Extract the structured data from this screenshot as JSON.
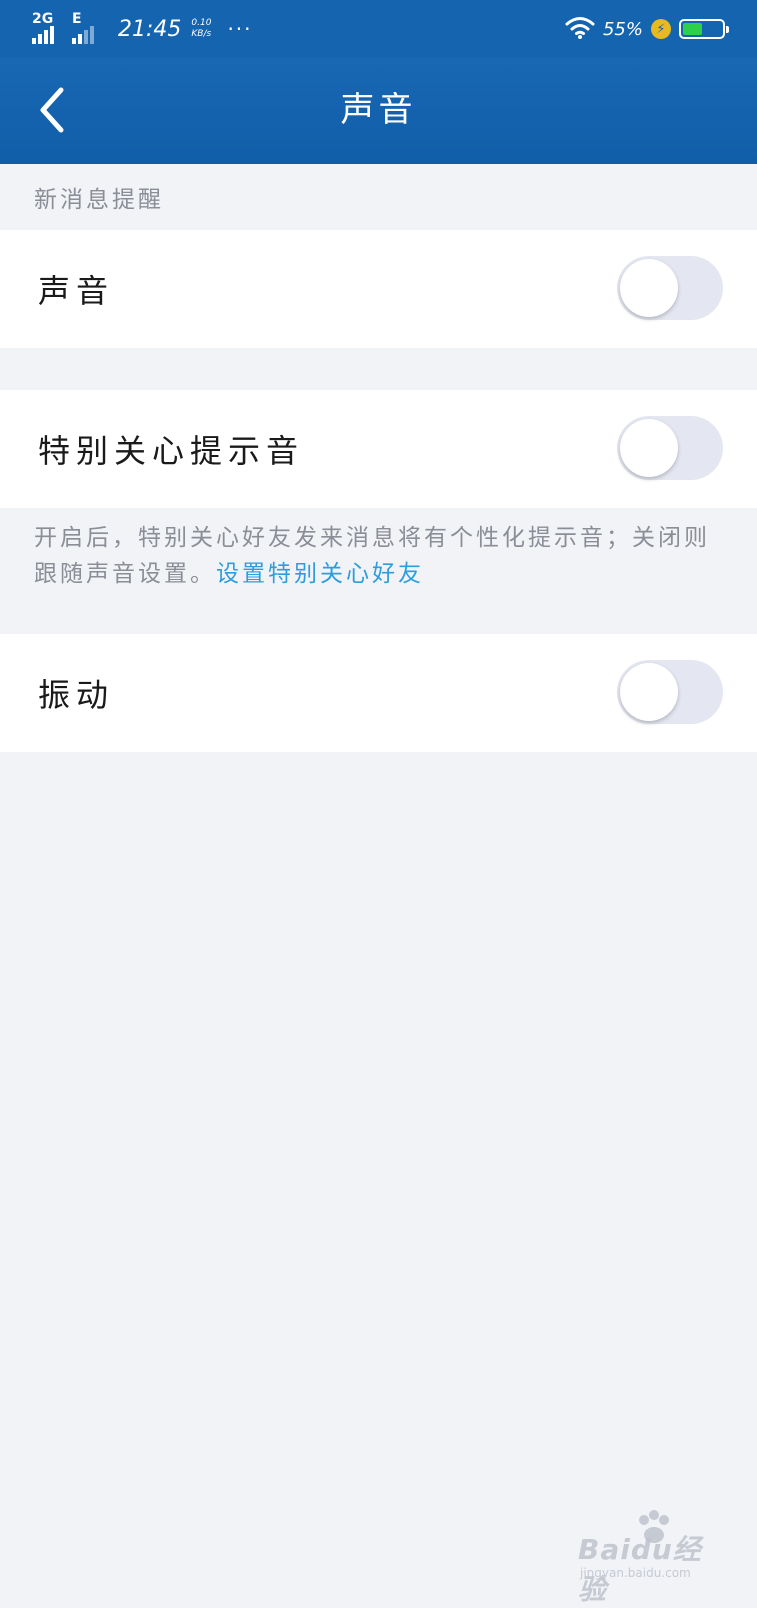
{
  "status_bar": {
    "network_primary": "2G",
    "network_secondary": "E",
    "time": "21:45",
    "speed_value": "0.10",
    "speed_unit": "KB/s",
    "more": "···",
    "battery_percent": "55%",
    "battery_level": 0.55,
    "battery_color": "#2ed04a",
    "icons": [
      "signal-icon",
      "wifi-icon",
      "charging-icon",
      "battery-icon"
    ]
  },
  "nav": {
    "title": "声音",
    "back_icon": "chevron-left-icon",
    "background": "#1464b0"
  },
  "section": {
    "header": "新消息提醒"
  },
  "settings": [
    {
      "label": "声音",
      "enabled": false
    },
    {
      "label": "特别关心提示音",
      "enabled": false
    },
    {
      "label": "振动",
      "enabled": false
    }
  ],
  "description": {
    "text": "开启后，特别关心好友发来消息将有个性化提示音；关闭则跟随声音设置。",
    "link": "设置特别关心好友",
    "link_color": "#2d9ddc"
  },
  "watermark": {
    "logo": "Baidu经验",
    "url": "jingyan.baidu.com"
  }
}
